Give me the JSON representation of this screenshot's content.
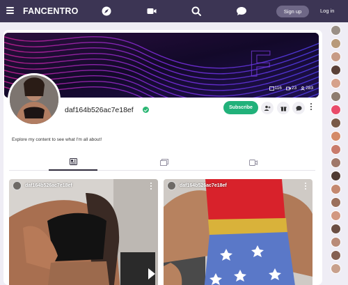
{
  "header": {
    "brand": "FANCENTRO",
    "signup_label": "Sign up",
    "login_label": "Log in",
    "icons": [
      "menu-icon",
      "explore-icon",
      "video-icon",
      "search-icon",
      "chat-icon"
    ]
  },
  "profile": {
    "username": "daf164b526ac7e18ef",
    "bio": "Explore my content to see what I'm all about!",
    "subscribe_label": "Subscribe",
    "stats": {
      "images": "116",
      "videos": "23",
      "followers": "283"
    }
  },
  "tabs": [
    {
      "name": "posts",
      "icon": "feed-icon",
      "active": true
    },
    {
      "name": "galleries",
      "icon": "gallery-icon",
      "active": false
    },
    {
      "name": "videos",
      "icon": "video-icon",
      "active": false
    }
  ],
  "posts": [
    {
      "author": "daf164b526ac7e18ef"
    },
    {
      "author": "daf164b526ac7e18ef"
    }
  ],
  "colors": {
    "topbar": "#3c3554",
    "accent": "#21b17a",
    "background": "#efedf5"
  }
}
